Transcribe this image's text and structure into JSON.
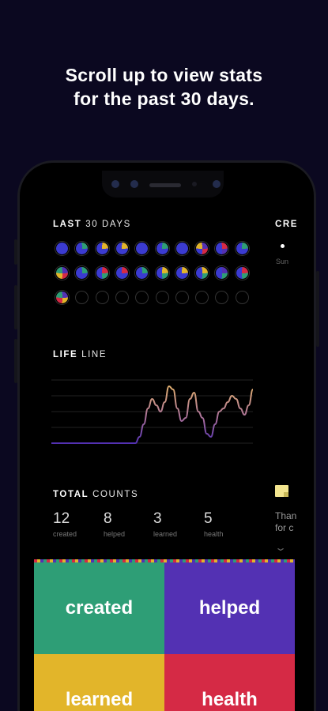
{
  "promo": {
    "line1": "Scroll up to view stats",
    "line2": "for the past 30 days."
  },
  "last30": {
    "title_bold": "LAST",
    "title_light": "30 DAYS",
    "days": [
      [
        "#3b3bd0",
        "#3b3bd0",
        "#3b3bd0",
        "#3b3bd0"
      ],
      [
        "#2e9e76",
        "#3b3bd0",
        "#3b3bd0",
        "#3b3bd0"
      ],
      [
        "#e2b52a",
        "#3b3bd0",
        "#3b3bd0",
        "#3b3bd0"
      ],
      [
        "#e2b52a",
        "#3b3bd0",
        "#3b3bd0",
        "#3b3bd0"
      ],
      [
        "#3b3bd0",
        "#3b3bd0",
        "#3b3bd0",
        "#3b3bd0"
      ],
      [
        "#2e9e76",
        "#3b3bd0",
        "#3b3bd0",
        "#3b3bd0"
      ],
      [
        "#3b3bd0",
        "#3b3bd0",
        "#3b3bd0",
        "#3b3bd0"
      ],
      [
        "#5331b3",
        "#d52a45",
        "#3b3bd0",
        "#e2b52a"
      ],
      [
        "#d52a45",
        "#5331b3",
        "#3b3bd0",
        "#3b3bd0"
      ],
      [
        "#2e9e76",
        "#3b3bd0",
        "#3b3bd0",
        "#3b3bd0"
      ],
      [
        "#5331b3",
        "#d52a45",
        "#e2b52a",
        "#2e9e76"
      ],
      [
        "#2e9e76",
        "#3b3bd0",
        "#3b3bd0",
        "#3b3bd0"
      ],
      [
        "#d52a45",
        "#2e9e76",
        "#3b3bd0",
        "#3b3bd0"
      ],
      [
        "#d52a45",
        "#3b3bd0",
        "#3b3bd0",
        "#3b3bd0"
      ],
      [
        "#2e9e76",
        "#3b3bd0",
        "#3b3bd0",
        "#3b3bd0"
      ],
      [
        "#e2b52a",
        "#2e9e76",
        "#3b3bd0",
        "#3b3bd0"
      ],
      [
        "#e2b52a",
        "#3b3bd0",
        "#3b3bd0",
        "#3b3bd0"
      ],
      [
        "#e2b52a",
        "#2e9e76",
        "#3b3bd0",
        "#3b3bd0"
      ],
      [
        "#5331b3",
        "#2e9e76",
        "#3b3bd0",
        "#3b3bd0"
      ],
      [
        "#d52a45",
        "#2e9e76",
        "#3b3bd0",
        "#3b3bd0"
      ],
      [
        "#5331b3",
        "#e2b52a",
        "#d52a45",
        "#2e9e76"
      ],
      null,
      null,
      null,
      null,
      null,
      null,
      null,
      null,
      null
    ]
  },
  "peek_card": {
    "title": "CRE",
    "day": "Sun"
  },
  "lifeline": {
    "title_bold": "LIFE",
    "title_light": "LINE",
    "values": [
      0,
      0,
      0,
      0,
      0,
      0,
      0,
      0,
      0,
      0,
      0,
      0,
      0,
      0,
      0,
      0,
      0,
      0,
      0,
      0,
      0,
      0.1,
      0.3,
      0.55,
      0.7,
      0.6,
      0.5,
      0.65,
      0.9,
      0.85,
      0.55,
      0.35,
      0.4,
      0.7,
      0.8,
      0.5,
      0.4,
      0.15,
      0.1,
      0.3,
      0.5,
      0.55,
      0.65,
      0.75,
      0.7,
      0.55,
      0.45,
      0.6,
      0.85
    ]
  },
  "totals": {
    "title_bold": "TOTAL",
    "title_light": "COUNTS",
    "items": [
      {
        "n": "12",
        "label": "created"
      },
      {
        "n": "8",
        "label": "helped"
      },
      {
        "n": "3",
        "label": "learned"
      },
      {
        "n": "5",
        "label": "health"
      }
    ]
  },
  "peek_note": {
    "line1": "Than",
    "line2": "for c"
  },
  "tiles": [
    {
      "label": "created",
      "color": "#2e9e76"
    },
    {
      "label": "helped",
      "color": "#5331b3"
    },
    {
      "label": "learned",
      "color": "#e2b52a"
    },
    {
      "label": "health",
      "color": "#d52a45"
    }
  ]
}
